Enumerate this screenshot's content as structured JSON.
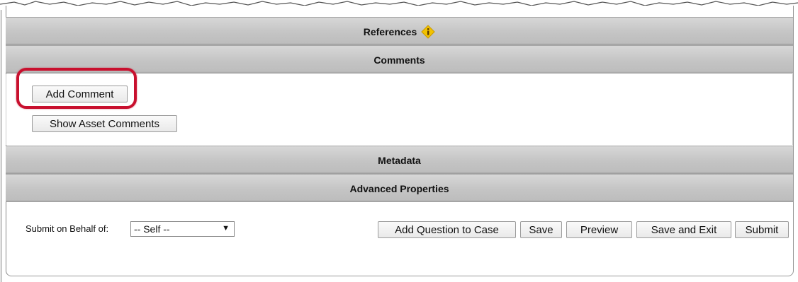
{
  "sections": {
    "references": "References",
    "comments": "Comments",
    "metadata": "Metadata",
    "advanced": "Advanced Properties"
  },
  "comments": {
    "add_comment": "Add Comment",
    "show_asset_comments": "Show Asset Comments"
  },
  "footer": {
    "submit_label": "Submit on Behalf of:",
    "submit_value": "-- Self --",
    "buttons": {
      "add_question": "Add Question to Case",
      "save": "Save",
      "preview": "Preview",
      "save_exit": "Save and Exit",
      "submit": "Submit"
    }
  },
  "colors": {
    "highlight": "#c8102e",
    "info_icon": "#f2c200"
  }
}
